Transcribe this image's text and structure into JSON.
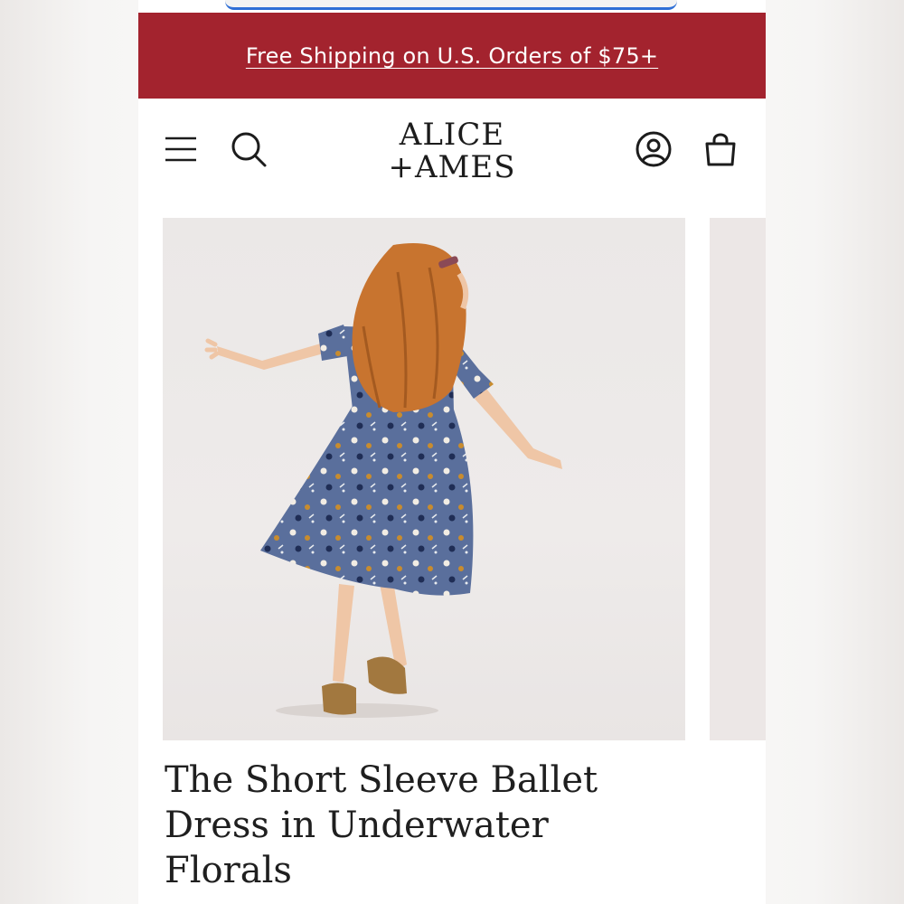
{
  "promo_banner": {
    "text": "Free Shipping on U.S. Orders of $75+",
    "background": "#a3232e"
  },
  "header": {
    "logo_line1": "ALICE",
    "logo_line2": "+AMES",
    "icons": [
      "menu-icon",
      "search-icon",
      "account-icon",
      "cart-icon"
    ]
  },
  "product": {
    "image_alt": "Girl twirling in a blue floral short sleeve ballet dress",
    "title": "The Short Sleeve Ballet Dress in Underwater Florals"
  },
  "colors": {
    "accent": "#a3232e",
    "dress": "#5a6f9c",
    "hair": "#c8742f"
  }
}
